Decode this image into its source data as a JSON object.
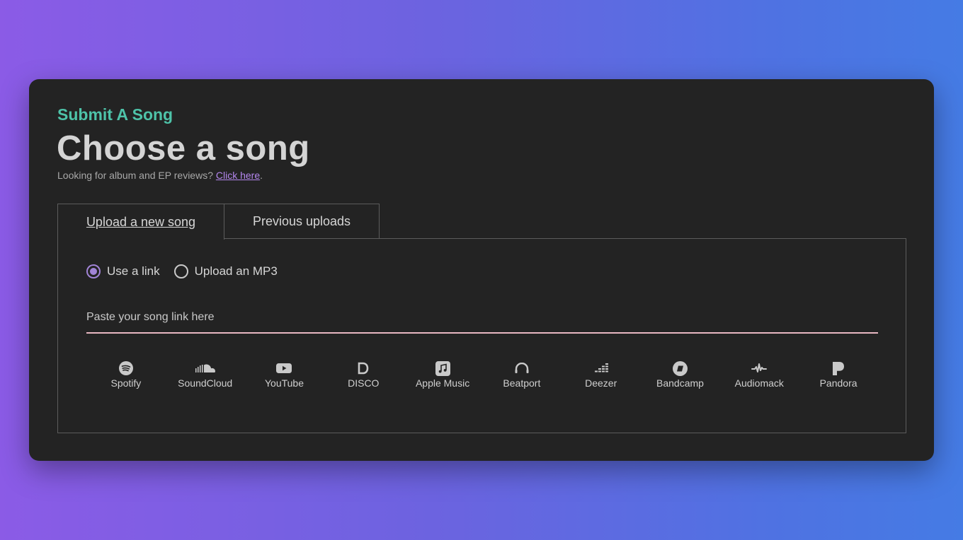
{
  "header": {
    "eyebrow": "Submit A Song",
    "title": "Choose a song",
    "subtitle_text": "Looking for album and EP reviews?",
    "subtitle_link": "Click here",
    "subtitle_suffix": "."
  },
  "tabs": [
    {
      "label": "Upload a new song",
      "active": true
    },
    {
      "label": "Previous uploads",
      "active": false
    }
  ],
  "source_options": [
    {
      "label": "Use a link",
      "checked": true
    },
    {
      "label": "Upload an MP3",
      "checked": false
    }
  ],
  "link_input": {
    "value": "",
    "placeholder": "Paste your song link here"
  },
  "services": [
    {
      "label": "Spotify",
      "icon": "spotify-icon"
    },
    {
      "label": "SoundCloud",
      "icon": "soundcloud-icon"
    },
    {
      "label": "YouTube",
      "icon": "youtube-icon"
    },
    {
      "label": "DISCO",
      "icon": "disco-icon"
    },
    {
      "label": "Apple Music",
      "icon": "apple-music-icon"
    },
    {
      "label": "Beatport",
      "icon": "beatport-icon"
    },
    {
      "label": "Deezer",
      "icon": "deezer-icon"
    },
    {
      "label": "Bandcamp",
      "icon": "bandcamp-icon"
    },
    {
      "label": "Audiomack",
      "icon": "audiomack-icon"
    },
    {
      "label": "Pandora",
      "icon": "pandora-icon"
    }
  ],
  "colors": {
    "accent_green": "#4ec3a9",
    "accent_purple": "#a184d6",
    "link_purple": "#b487ee",
    "input_underline": "#e8b8c2",
    "card_bg": "#232323"
  }
}
